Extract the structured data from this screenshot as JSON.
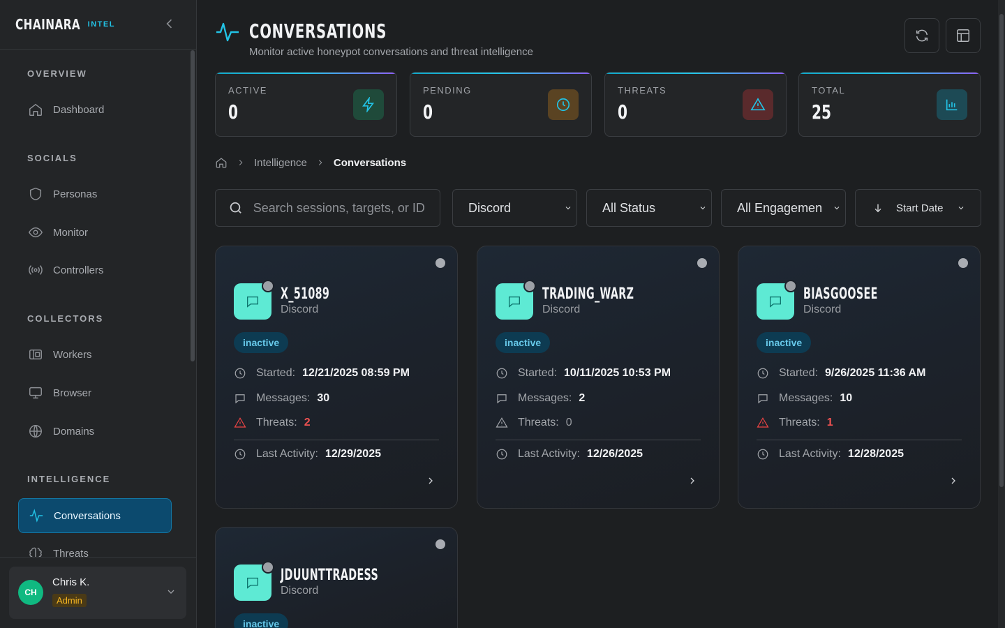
{
  "brand": {
    "name": "CHAINARA",
    "tag": "INTEL"
  },
  "sidebar": {
    "sections": [
      {
        "title": "OVERVIEW"
      },
      {
        "title": "SOCIALS"
      },
      {
        "title": "COLLECTORS"
      },
      {
        "title": "INTELLIGENCE"
      }
    ],
    "items": [
      {
        "label": "Dashboard",
        "icon": "home-icon"
      },
      {
        "label": "Personas",
        "icon": "shield-icon"
      },
      {
        "label": "Monitor",
        "icon": "eye-icon"
      },
      {
        "label": "Controllers",
        "icon": "radio-icon"
      },
      {
        "label": "Workers",
        "icon": "worker-icon"
      },
      {
        "label": "Browser",
        "icon": "monitor-icon"
      },
      {
        "label": "Domains",
        "icon": "globe-icon"
      },
      {
        "label": "Conversations",
        "icon": "activity-icon",
        "active": true
      },
      {
        "label": "Threats",
        "icon": "brain-icon"
      }
    ]
  },
  "user": {
    "initials": "CH",
    "name": "Chris K.",
    "role": "Admin"
  },
  "header": {
    "title": "CONVERSATIONS",
    "subtitle": "Monitor active honeypot conversations and threat intelligence"
  },
  "stats": [
    {
      "label": "ACTIVE",
      "value": "0",
      "icon": "lightning-icon",
      "color": "#22c3e6",
      "bg": "#1f4a3a"
    },
    {
      "label": "PENDING",
      "value": "0",
      "icon": "clock-icon",
      "color": "#22c3e6",
      "bg": "#5a4322"
    },
    {
      "label": "THREATS",
      "value": "0",
      "icon": "warning-icon",
      "color": "#22c3e6",
      "bg": "#5a2a2c"
    },
    {
      "label": "TOTAL",
      "value": "25",
      "icon": "bar-chart-icon",
      "color": "#22c3e6",
      "bg": "#1d4a55"
    }
  ],
  "breadcrumb": {
    "items": [
      "Intelligence",
      "Conversations"
    ]
  },
  "filters": {
    "search_placeholder": "Search sessions, targets, or ID",
    "platform": "Discord",
    "status": "All Status",
    "engagement": "All Engagemen",
    "sort": "Start Date"
  },
  "labels": {
    "started": "Started:",
    "messages": "Messages:",
    "threats": "Threats:",
    "last_activity": "Last Activity:"
  },
  "conversations": [
    {
      "name": "X_51089",
      "platform": "Discord",
      "status": "inactive",
      "started": "12/21/2025 08:59 PM",
      "messages": "30",
      "threats": "2",
      "last_activity": "12/29/2025"
    },
    {
      "name": "TRADING_WARZ",
      "platform": "Discord",
      "status": "inactive",
      "started": "10/11/2025 10:53 PM",
      "messages": "2",
      "threats": "0",
      "last_activity": "12/26/2025"
    },
    {
      "name": "BIASGOOSEE",
      "platform": "Discord",
      "status": "inactive",
      "started": "9/26/2025 11:36 AM",
      "messages": "10",
      "threats": "1",
      "last_activity": "12/28/2025"
    },
    {
      "name": "JDUUNTTRADESS",
      "platform": "Discord",
      "status": "inactive"
    }
  ]
}
